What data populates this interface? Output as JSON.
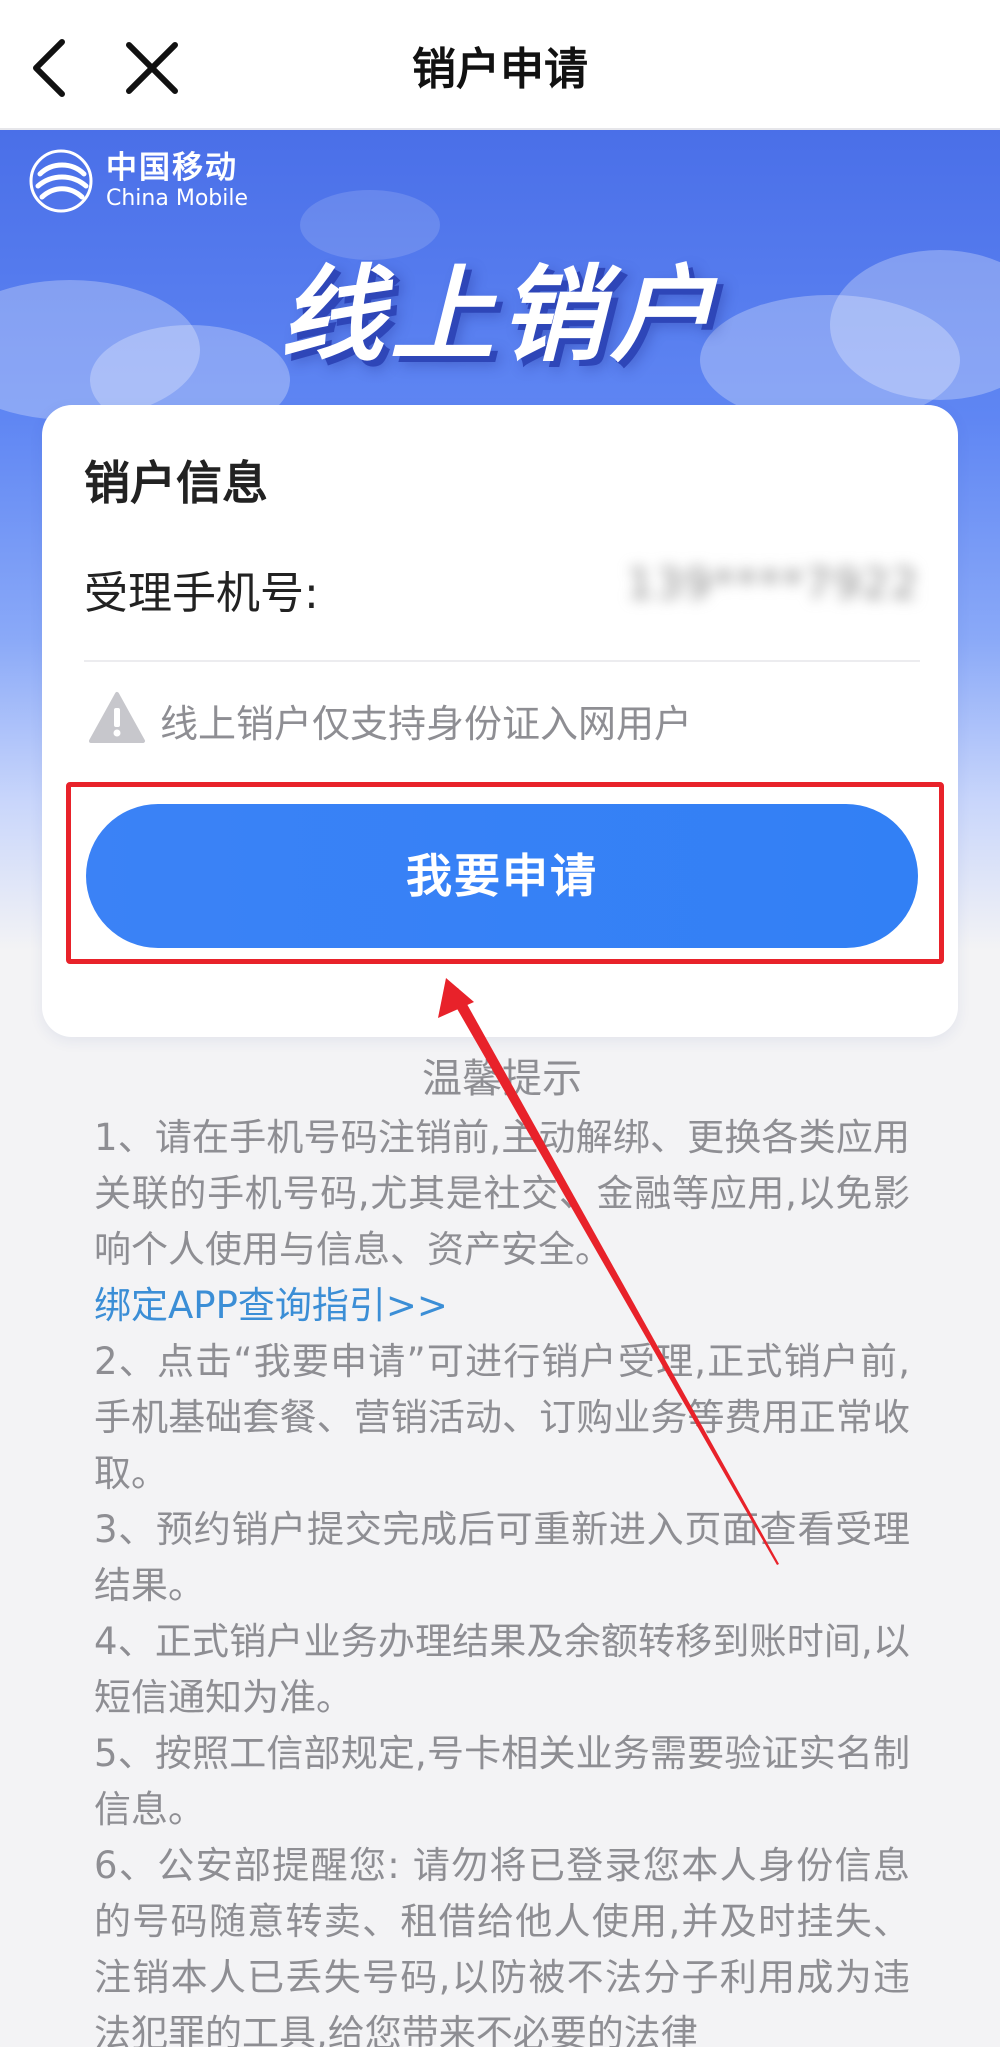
{
  "nav": {
    "title": "销户申请"
  },
  "brand": {
    "name_cn": "中国移动",
    "name_en": "China Mobile"
  },
  "hero": {
    "title": "线上销户"
  },
  "card": {
    "title": "销户信息",
    "phone_label": "受理手机号:",
    "phone_value": "139****7922",
    "warning": "线上销户仅支持身份证入网用户",
    "apply_button": "我要申请"
  },
  "tips": {
    "title": "温馨提示",
    "items": [
      "1、请在手机号码注销前,主动解绑、更换各类应用关联的手机号码,尤其是社交、金融等应用,以免影响个人使用与信息、资产安全。",
      "2、点击“我要申请”可进行销户受理,正式销户前,手机基础套餐、营销活动、订购业务等费用正常收取。",
      "3、预约销户提交完成后可重新进入页面查看受理结果。",
      "4、正式销户业务办理结果及余额转移到账时间,以短信通知为准。",
      "5、按照工信部规定,号卡相关业务需要验证实名制信息。",
      "6、公安部提醒您: 请勿将已登录您本人身份信息的号码随意转卖、租借给他人使用,并及时挂失、注销本人已丢失号码,以防被不法分子利用成为违法犯罪的工具,给您带来不必要的法律"
    ],
    "link": "绑定APP查询指引>>"
  },
  "colors": {
    "primary_button": "#3280f5",
    "highlight_red": "#e8222a",
    "link_blue": "#3b8ed6",
    "hero_blue": "#4a6fe8"
  },
  "icons": {
    "back": "chevron-left-icon",
    "close": "close-icon",
    "warning": "warning-triangle-icon",
    "logo": "china-mobile-logo"
  }
}
